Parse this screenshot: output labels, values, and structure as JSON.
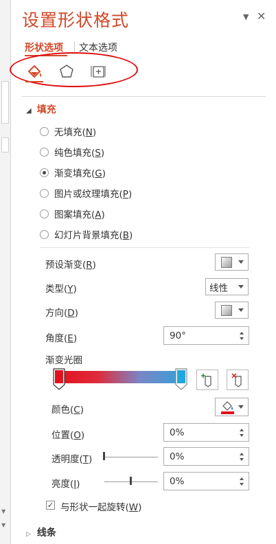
{
  "pane": {
    "title": "设置形状格式",
    "dropdown_glyph": "▼",
    "close_glyph": "✕"
  },
  "tabs": [
    {
      "label": "形状选项",
      "active": true
    },
    {
      "label": "文本选项",
      "active": false
    }
  ],
  "icons": [
    "fill-line-icon",
    "effects-pentagon-icon",
    "size-properties-icon"
  ],
  "fill": {
    "header": "填充",
    "options": [
      {
        "text": "无填充(",
        "key": "N",
        "selected": false
      },
      {
        "text": "纯色填充(",
        "key": "S",
        "selected": false
      },
      {
        "text": "渐变填充(",
        "key": "G",
        "selected": true
      },
      {
        "text": "图片或纹理填充(",
        "key": "P",
        "selected": false
      },
      {
        "text": "图案填充(",
        "key": "A",
        "selected": false
      },
      {
        "text": "幻灯片背景填充(",
        "key": "B",
        "selected": false
      }
    ],
    "preset": {
      "label": "预设渐变(",
      "key": "R"
    },
    "type": {
      "label": "类型(",
      "key": "Y",
      "value": "线性"
    },
    "direction": {
      "label": "方向(",
      "key": "D"
    },
    "angle": {
      "label": "角度(",
      "key": "E",
      "value": "90°"
    },
    "gradient_stops_label": "渐变光圈",
    "gradient_colors": [
      "#e2101d",
      "#e02b3b",
      "#7a86c6",
      "#35a0d8"
    ],
    "stop_colors": [
      "#e2101d",
      "#1fa7e0"
    ],
    "color": {
      "label": "颜色(",
      "key": "C",
      "swatch": "#e2101d"
    },
    "position": {
      "label": "位置(",
      "key": "O",
      "value": "0%"
    },
    "transparency": {
      "label": "透明度(",
      "key": "T",
      "value": "0%",
      "level": 0
    },
    "brightness": {
      "label": "亮度(",
      "key": "I",
      "value": "0%",
      "level": 0.5
    },
    "rotate": {
      "label": "与形状一起旋转(",
      "key": "W",
      "checked": true
    }
  },
  "line_section": "线条",
  "colors": {
    "accent": "#d24726",
    "annotation": "#e20a0a"
  }
}
